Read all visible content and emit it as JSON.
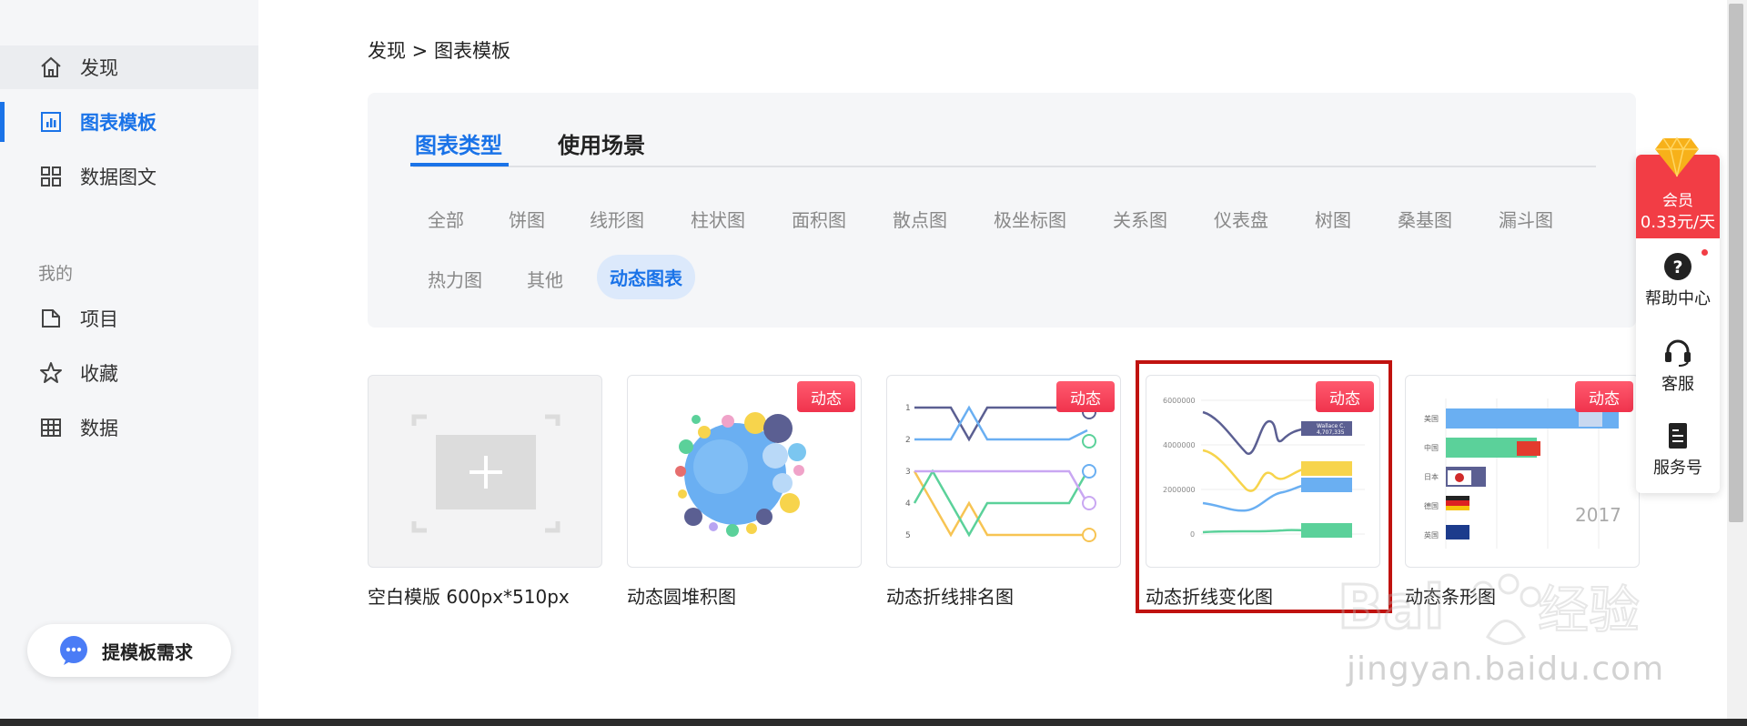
{
  "breadcrumb": "发现 > 图表模板",
  "sidebar": {
    "items": [
      {
        "label": "发现",
        "icon": "home-icon"
      },
      {
        "label": "图表模板",
        "icon": "bar-chart-icon"
      },
      {
        "label": "数据图文",
        "icon": "grid-icon"
      }
    ],
    "section_title": "我的",
    "my_items": [
      {
        "label": "项目",
        "icon": "folder-icon"
      },
      {
        "label": "收藏",
        "icon": "star-icon"
      },
      {
        "label": "数据",
        "icon": "table-icon"
      }
    ],
    "feedback_label": "提模板需求"
  },
  "tabs": [
    "图表类型",
    "使用场景"
  ],
  "categories": [
    "全部",
    "饼图",
    "线形图",
    "柱状图",
    "面积图",
    "散点图",
    "极坐标图",
    "关系图",
    "仪表盘",
    "树图",
    "桑基图",
    "漏斗图",
    "热力图",
    "其他",
    "动态图表"
  ],
  "active_category": "动态图表",
  "cards": [
    {
      "label": "空白模版 600px*510px",
      "badge": ""
    },
    {
      "label": "动态圆堆积图",
      "badge": "动态"
    },
    {
      "label": "动态折线排名图",
      "badge": "动态"
    },
    {
      "label": "动态折线变化图",
      "badge": "动态"
    },
    {
      "label": "动态条形图",
      "badge": "动态"
    }
  ],
  "line_change_chart": {
    "y_ticks": [
      "6000000",
      "4000000",
      "2000000",
      "0"
    ],
    "tags": [
      "Wallace C.",
      "4,707,335"
    ]
  },
  "bar_chart_thumb": {
    "countries": [
      "美国",
      "中国",
      "日本",
      "德国",
      "英国"
    ],
    "year": "2017"
  },
  "rank_chart_thumb": {
    "ranks": [
      "1",
      "2",
      "3",
      "4",
      "5"
    ]
  },
  "float_bar": {
    "vip_label": "会员",
    "vip_price": "0.33元/天",
    "items": [
      "帮助中心",
      "客服",
      "服务号"
    ]
  },
  "watermark": {
    "text": "jingyan.baidu.com",
    "brand": "Bai 经验"
  },
  "colors": {
    "accent": "#1a73e8",
    "badge": "#f0334d",
    "highlight": "#c0120f"
  }
}
